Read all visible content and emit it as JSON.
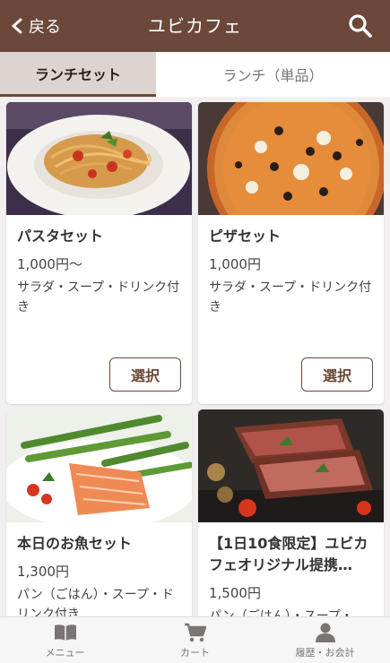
{
  "header": {
    "back_label": "戻る",
    "title": "ユビカフェ",
    "back_icon": "chevron-left-icon",
    "search_icon": "search-icon"
  },
  "tabs": [
    {
      "label": "ランチセット",
      "active": true
    },
    {
      "label": "ランチ（単品）",
      "active": false
    }
  ],
  "menu_items": [
    {
      "name": "パスタセット",
      "price": "1,000円〜",
      "description": "サラダ・スープ・ドリンク付き",
      "button_label": "選択"
    },
    {
      "name": "ピザセット",
      "price": "1,000円",
      "description": "サラダ・スープ・ドリンク付き",
      "button_label": "選択"
    },
    {
      "name": "本日のお魚セット",
      "price": "1,300円",
      "description": "パン（ごはん）・スープ・ドリンク付き"
    },
    {
      "name": "【1日10食限定】ユビカフェオリジナル提携…",
      "price": "1,500円",
      "description": "パン（ごはん）・スープ・"
    }
  ],
  "bottom_nav": [
    {
      "label": "メニュー",
      "icon": "book-icon"
    },
    {
      "label": "カート",
      "icon": "cart-icon"
    },
    {
      "label": "履歴・お会計",
      "icon": "person-icon"
    }
  ],
  "colors": {
    "brand": "#6b4839",
    "active_tab_bg": "#ddd4d1",
    "page_bg": "#f1efef"
  }
}
